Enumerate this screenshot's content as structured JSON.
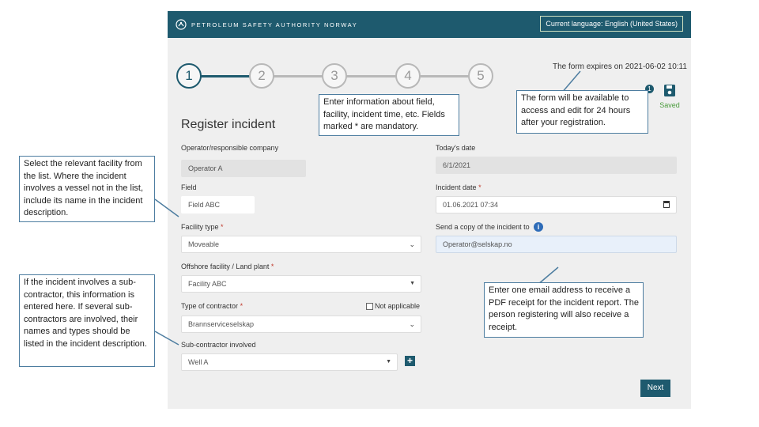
{
  "header": {
    "brand": "PETROLEUM SAFETY AUTHORITY NORWAY",
    "language_button": "Current language: English (United States)"
  },
  "expires_text": "The form expires on 2021-06-02 10:11",
  "steps": [
    "1",
    "2",
    "3",
    "4",
    "5"
  ],
  "saved_label": "Saved",
  "page_title": "Register incident",
  "form": {
    "operator": {
      "label": "Operator/responsible company",
      "value": "Operator A"
    },
    "todays_date": {
      "label": "Today's date",
      "value": "6/1/2021"
    },
    "field": {
      "label": "Field",
      "value": "Field ABC",
      "required": "*"
    },
    "incident_date": {
      "label": "Incident date",
      "value": "01.06.2021 07:34",
      "required": "*"
    },
    "facility_type": {
      "label": "Facility type",
      "value": "Moveable",
      "required": "*"
    },
    "send_copy": {
      "label": "Send a copy of the incident to",
      "value": "Operator@selskap.no"
    },
    "offshore_facility": {
      "label": "Offshore facility / Land plant",
      "value": "Facility ABC",
      "required": "*"
    },
    "contractor_type": {
      "label": "Type of contractor",
      "value": "Brannserviceselskap",
      "required": "*"
    },
    "not_applicable": "Not applicable",
    "subcontractor": {
      "label": "Sub-contractor involved",
      "value": "Well A"
    }
  },
  "next_label": "Next",
  "callouts": {
    "field_info": "Enter information about field, facility, incident time, etc. Fields marked * are mandatory.",
    "availability": "The form will be available to access and edit for 24 hours after your registration.",
    "facility_select": "Select the relevant facility from the list. Where the incident involves a vessel not in the list, include its name in the incident description.",
    "subcontractor": "If the incident involves a sub-contractor, this information is entered here. If several sub-contractors are involved, their names and types should be listed in the incident description.",
    "email": "Enter one email address to receive a PDF receipt for the incident report. The person registering will also receive a receipt."
  },
  "colors": {
    "brand": "#1e5a6e",
    "saved": "#4a9b3c",
    "required": "#c0392b",
    "info": "#2e6cb8"
  }
}
